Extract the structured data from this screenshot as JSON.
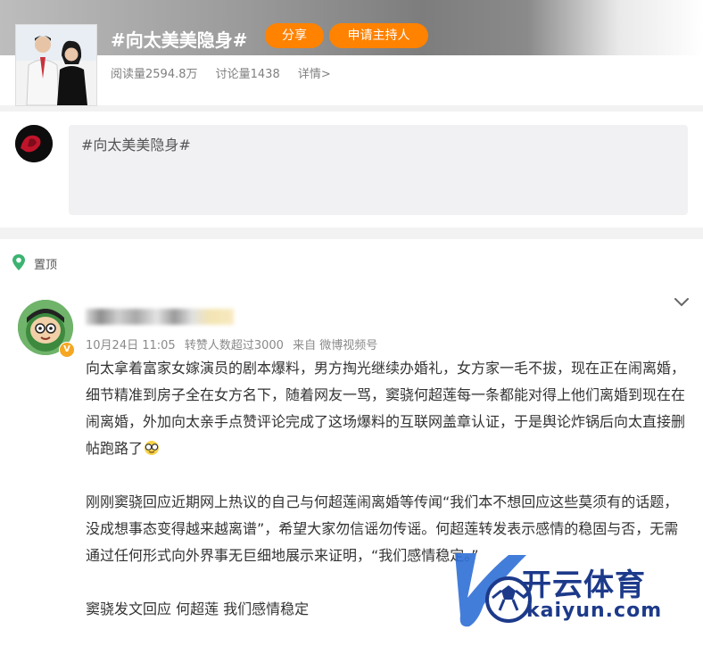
{
  "topic": {
    "title": "#向太美美隐身#",
    "share_label": "分享",
    "apply_host_label": "申请主持人",
    "read_count": "阅读量2594.8万",
    "discuss_count": "讨论量1438",
    "details_label": "详情>"
  },
  "composer": {
    "text": "#向太美美隐身#"
  },
  "feed": {
    "pinned_label": "置顶",
    "post": {
      "meta": {
        "time": "10月24日 11:05",
        "reposts": "转赞人数超过3000",
        "source": "来自 微博视频号"
      },
      "paragraphs": [
        "向太拿着富家女嫁演员的剧本爆料，男方掏光继续办婚礼，女方家一毛不拔，现在正在闹离婚，细节精准到房子全在女方名下，随着网友一骂，窦骁何超莲每一条都能对得上他们离婚到现在在闹离婚，外加向太亲手点赞评论完成了这场爆料的互联网盖章认证，于是舆论炸锅后向太直接删帖跑路了",
        "刚刚窦骁回应近期网上热议的自己与何超莲闹离婚等传闻“我们本不想回应这些莫须有的话题，没成想事态变得越来越离谱”，希望大家勿信谣勿传谣。何超莲转发表示感情的稳固与否，无需通过任何形式向外界事无巨细地展示来证明，“我们感情稳定。”",
        "窦骁发文回应 何超莲 我们感情稳定"
      ]
    }
  },
  "watermark": {
    "brand": "开云体育",
    "url": "kaiyun.com"
  },
  "colors": {
    "accent_orange": "#ff8200",
    "text_gray": "#808080",
    "watermark_blue": "#1d3a8a"
  },
  "icons": [
    "pin-location-icon",
    "chevron-down-icon",
    "verified-v-icon",
    "glasses-face-emoji-icon"
  ]
}
